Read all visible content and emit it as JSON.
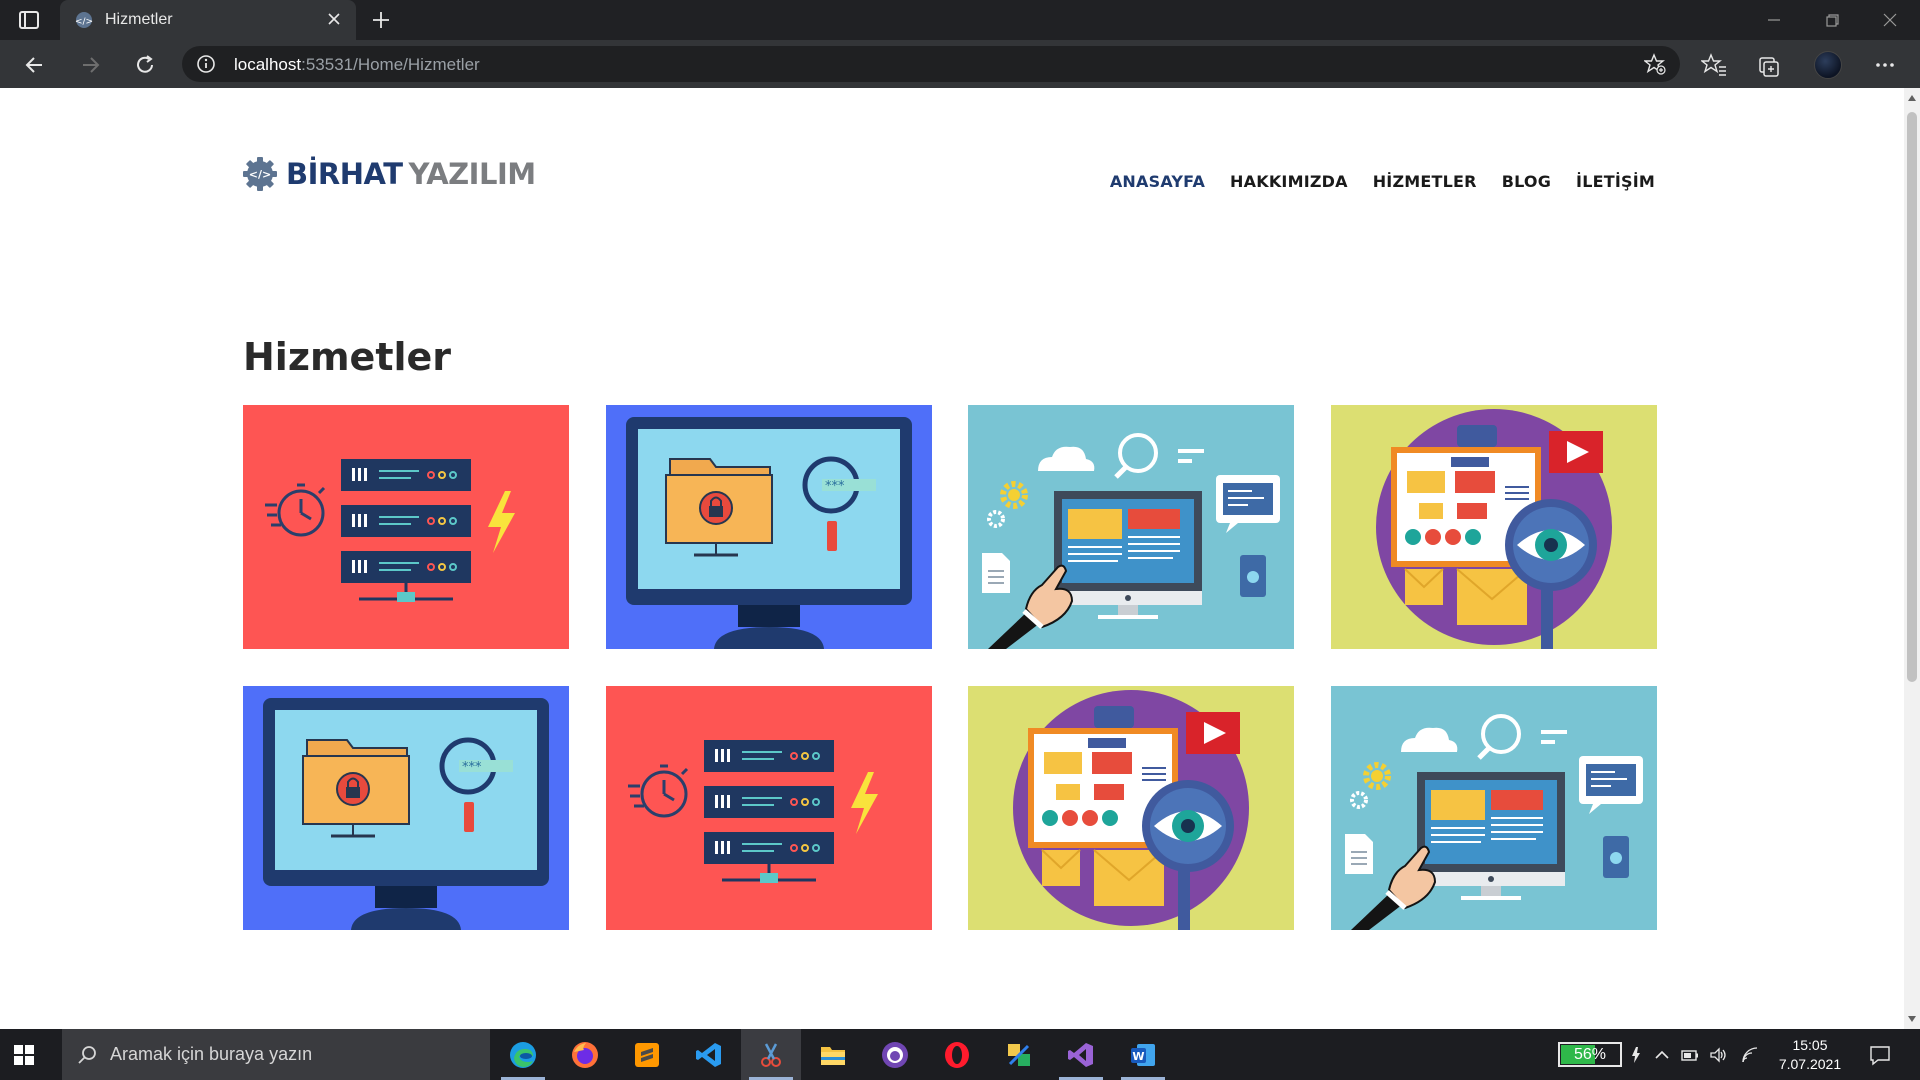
{
  "browser": {
    "tab_title": "Hizmetler",
    "address_host": "localhost",
    "address_rest": ":53531/Home/Hizmetler"
  },
  "site": {
    "brand_primary": "BİRHAT",
    "brand_secondary": "YAZILIM",
    "nav": {
      "home": "ANASAYFA",
      "about": "HAKKIMIZDA",
      "services": "HİZMETLER",
      "blog": "BLOG",
      "contact": "İLETİŞİM"
    },
    "active_nav": "ANASAYFA",
    "page_title": "Hizmetler",
    "colors": {
      "brand_blue": "#1f3b6f",
      "brand_gray": "#7b7d80",
      "card_red": "#fe5553",
      "card_blue": "#4f6ff9",
      "card_teal": "#79c4d3",
      "card_yellow": "#dcdf72"
    },
    "service_cards": [
      {
        "illustration": "server-speed",
        "background": "#fe5553"
      },
      {
        "illustration": "secure-folder-monitor",
        "background": "#4f6ff9"
      },
      {
        "illustration": "web-analytics-touch",
        "background": "#79c4d3"
      },
      {
        "illustration": "eye-magnifier-flowchart",
        "background": "#dcdf72"
      },
      {
        "illustration": "secure-folder-monitor",
        "background": "#4f6ff9"
      },
      {
        "illustration": "server-speed",
        "background": "#fe5553"
      },
      {
        "illustration": "eye-magnifier-flowchart",
        "background": "#dcdf72"
      },
      {
        "illustration": "web-analytics-touch",
        "background": "#79c4d3"
      }
    ]
  },
  "taskbar": {
    "search_placeholder": "Aramak için buraya yazın",
    "apps": [
      "edge-icon",
      "firefox-icon",
      "sublime-text-icon",
      "vscode-icon",
      "snipping-tool-icon",
      "file-explorer-icon",
      "github-desktop-icon",
      "opera-icon",
      "tool-icon",
      "visual-studio-icon",
      "word-icon"
    ],
    "battery_percent": "56%",
    "battery_level": 0.56,
    "time": "15:05",
    "date": "7.07.2021"
  }
}
